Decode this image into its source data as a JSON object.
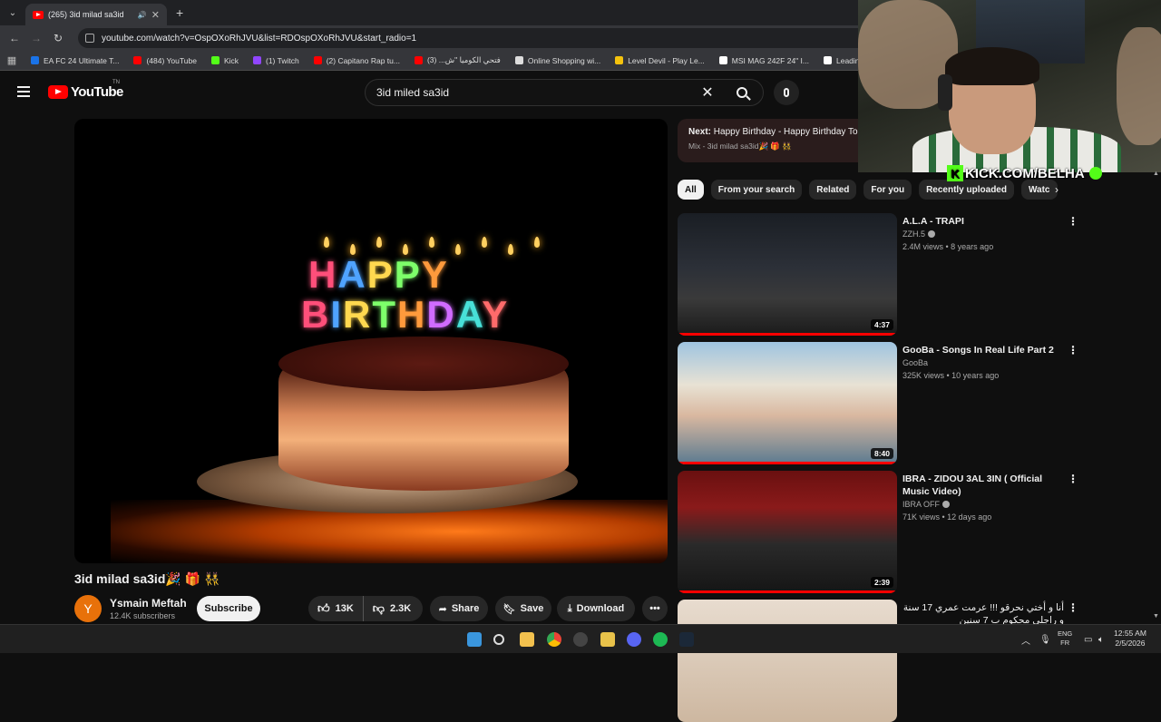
{
  "browser": {
    "tab_title": "(265) 3id milad sa3id",
    "url": "youtube.com/watch?v=OspOXoRhJVU&list=RDOspOXoRhJVU&start_radio=1",
    "bookmarks": [
      {
        "label": "EA FC 24 Ultimate T...",
        "color": "#1a73e8"
      },
      {
        "label": "(484) YouTube",
        "color": "#ff0000"
      },
      {
        "label": "Kick",
        "color": "#53fc18"
      },
      {
        "label": "(1) Twitch",
        "color": "#9146ff"
      },
      {
        "label": "(2) Capitano Rap tu...",
        "color": "#ff0000"
      },
      {
        "label": "فتحي الكوميا \"ش... (3)",
        "color": "#ff0000"
      },
      {
        "label": "Online Shopping wi...",
        "color": "#dddddd"
      },
      {
        "label": "Level Devil - Play Le...",
        "color": "#f4c20d"
      },
      {
        "label": "MSI MAG 242F 24\" I...",
        "color": "#ffffff"
      },
      {
        "label": "Leading Digital Stor...",
        "color": "#ffffff"
      }
    ]
  },
  "youtube": {
    "logo_text": "YouTube",
    "logo_tn": "TN",
    "search_value": "3id miled sa3id"
  },
  "video": {
    "title": "3id milad sa3id🎉 🎁 👯",
    "channel_initial": "Y",
    "channel_name": "Ysmain Meftah",
    "subscribers": "12.4K subscribers",
    "subscribe_label": "Subscribe",
    "likes": "13K",
    "dislikes": "2.3K",
    "share_label": "Share",
    "save_label": "Save",
    "download_label": "Download",
    "cake_line1": "HAPPY",
    "cake_line2": "BIRTHDAY"
  },
  "next": {
    "label": "Next:",
    "title": "Happy Birthday - Happy Birthday To",
    "subtitle": "Mix - 3id milad sa3id🎉 🎁 👯"
  },
  "chips": [
    "All",
    "From your search",
    "Related",
    "For you",
    "Recently uploaded",
    "Watc"
  ],
  "recommendations": [
    {
      "title": "A.L.A - TRAPI",
      "channel": "ZZH.5",
      "verified": true,
      "meta": "2.4M views • 8 years ago",
      "duration": "4:37",
      "progress": 1.0
    },
    {
      "title": "GooBa - Songs In Real Life Part 2",
      "channel": "GooBa",
      "verified": false,
      "meta": "325K views • 10 years ago",
      "duration": "8:40",
      "progress": 1.0
    },
    {
      "title": "IBRA - ZIDOU 3AL 3IN ( Official Music Video)",
      "channel": "IBRA OFF",
      "verified": true,
      "meta": "71K views • 12 days ago",
      "duration": "2:39",
      "progress": 1.0
    },
    {
      "title": "أنا و أختي نحرقو !!! عرمت عمري 17 سنة و راجلي محكوم ب 7 سنين",
      "channel": "",
      "verified": false,
      "meta": "",
      "duration": "",
      "progress": 0
    }
  ],
  "overlay": {
    "kick_text": "KICK.COM/BELHA"
  },
  "taskbar": {
    "lang_top": "ENG",
    "lang_bottom": "FR",
    "time": "12:55 AM",
    "date": "2/5/2026"
  }
}
